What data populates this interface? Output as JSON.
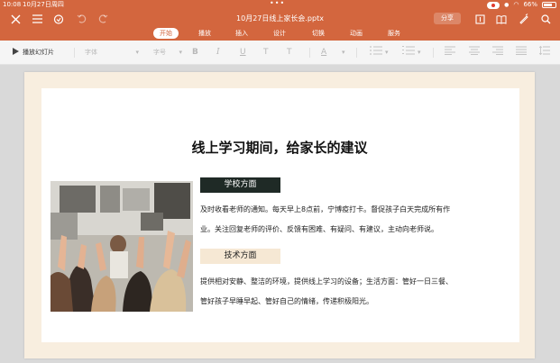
{
  "status_bar": {
    "time": "10:08",
    "date": "10月27日周四",
    "battery": "66%"
  },
  "document": {
    "title": "10月27日线上家长会.pptx",
    "share_label": "分享"
  },
  "ribbon_tabs": [
    {
      "label": "开始",
      "active": true
    },
    {
      "label": "播放",
      "active": false
    },
    {
      "label": "插入",
      "active": false
    },
    {
      "label": "设计",
      "active": false
    },
    {
      "label": "切换",
      "active": false
    },
    {
      "label": "动画",
      "active": false
    },
    {
      "label": "服务",
      "active": false
    }
  ],
  "toolbar": {
    "play_slideshow_label": "播放幻灯片",
    "font_placeholder": "字体",
    "font_size_placeholder": "字号",
    "bold": "B",
    "italic": "I",
    "underline": "U",
    "strikethrough": "T",
    "superscript": "T",
    "font_color": "A"
  },
  "slide": {
    "title": "线上学习期间，给家长的建议",
    "school_heading": "学校方面",
    "school_lines": [
      "及时收看老师的通知。每天早上8点前，宁博疫打卡。督促孩子白天完成所有作",
      "业。关注回复老师的评价、反馈有困难、有疑问、有建议，主动向老师说。"
    ],
    "tech_heading": "技术方面",
    "tech_lines": [
      "提供相对安静、整洁的环境，提供线上学习的设备；生活方面：管好一日三餐、",
      "管好孩子早睡早起、管好自己的情绪，传递积极阳光。"
    ]
  },
  "colors": {
    "accent": "#d3663e",
    "slide_border": "#f8eedf",
    "dark_label": "#1f2a26",
    "light_label": "#f6e8d4"
  }
}
